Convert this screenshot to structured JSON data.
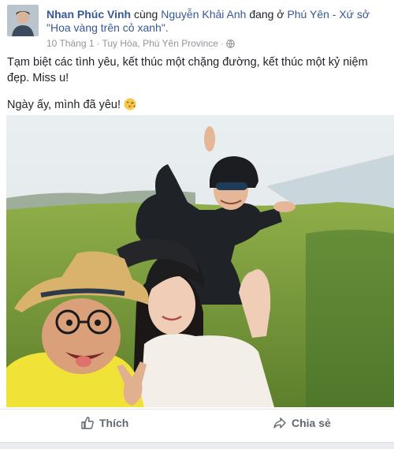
{
  "post": {
    "author": "Nhan Phúc Vinh",
    "with_word": "cùng",
    "tagged": "Nguyễn Khải Anh",
    "at_word": "đang ở",
    "place": "Phú Yên - Xứ sở \"Hoa vàng trên cỏ xanh\".",
    "date": "10 Tháng 1",
    "separator": "·",
    "location": "Tuy Hòa, Phú Yên Province",
    "privacy_icon": "globe-icon",
    "text_line1": "Tạm biệt các tình yêu, kết thúc một chặng đường, kết thúc một kỷ niệm đẹp. Miss u!",
    "text_line2": "Ngày ấy, mình đã yêu!",
    "emoji": "kiss-emoji"
  },
  "actions": {
    "like_label": "Thích",
    "share_label": "Chia sẻ"
  },
  "colors": {
    "link": "#365899",
    "meta": "#90949c",
    "text": "#1d2129"
  }
}
